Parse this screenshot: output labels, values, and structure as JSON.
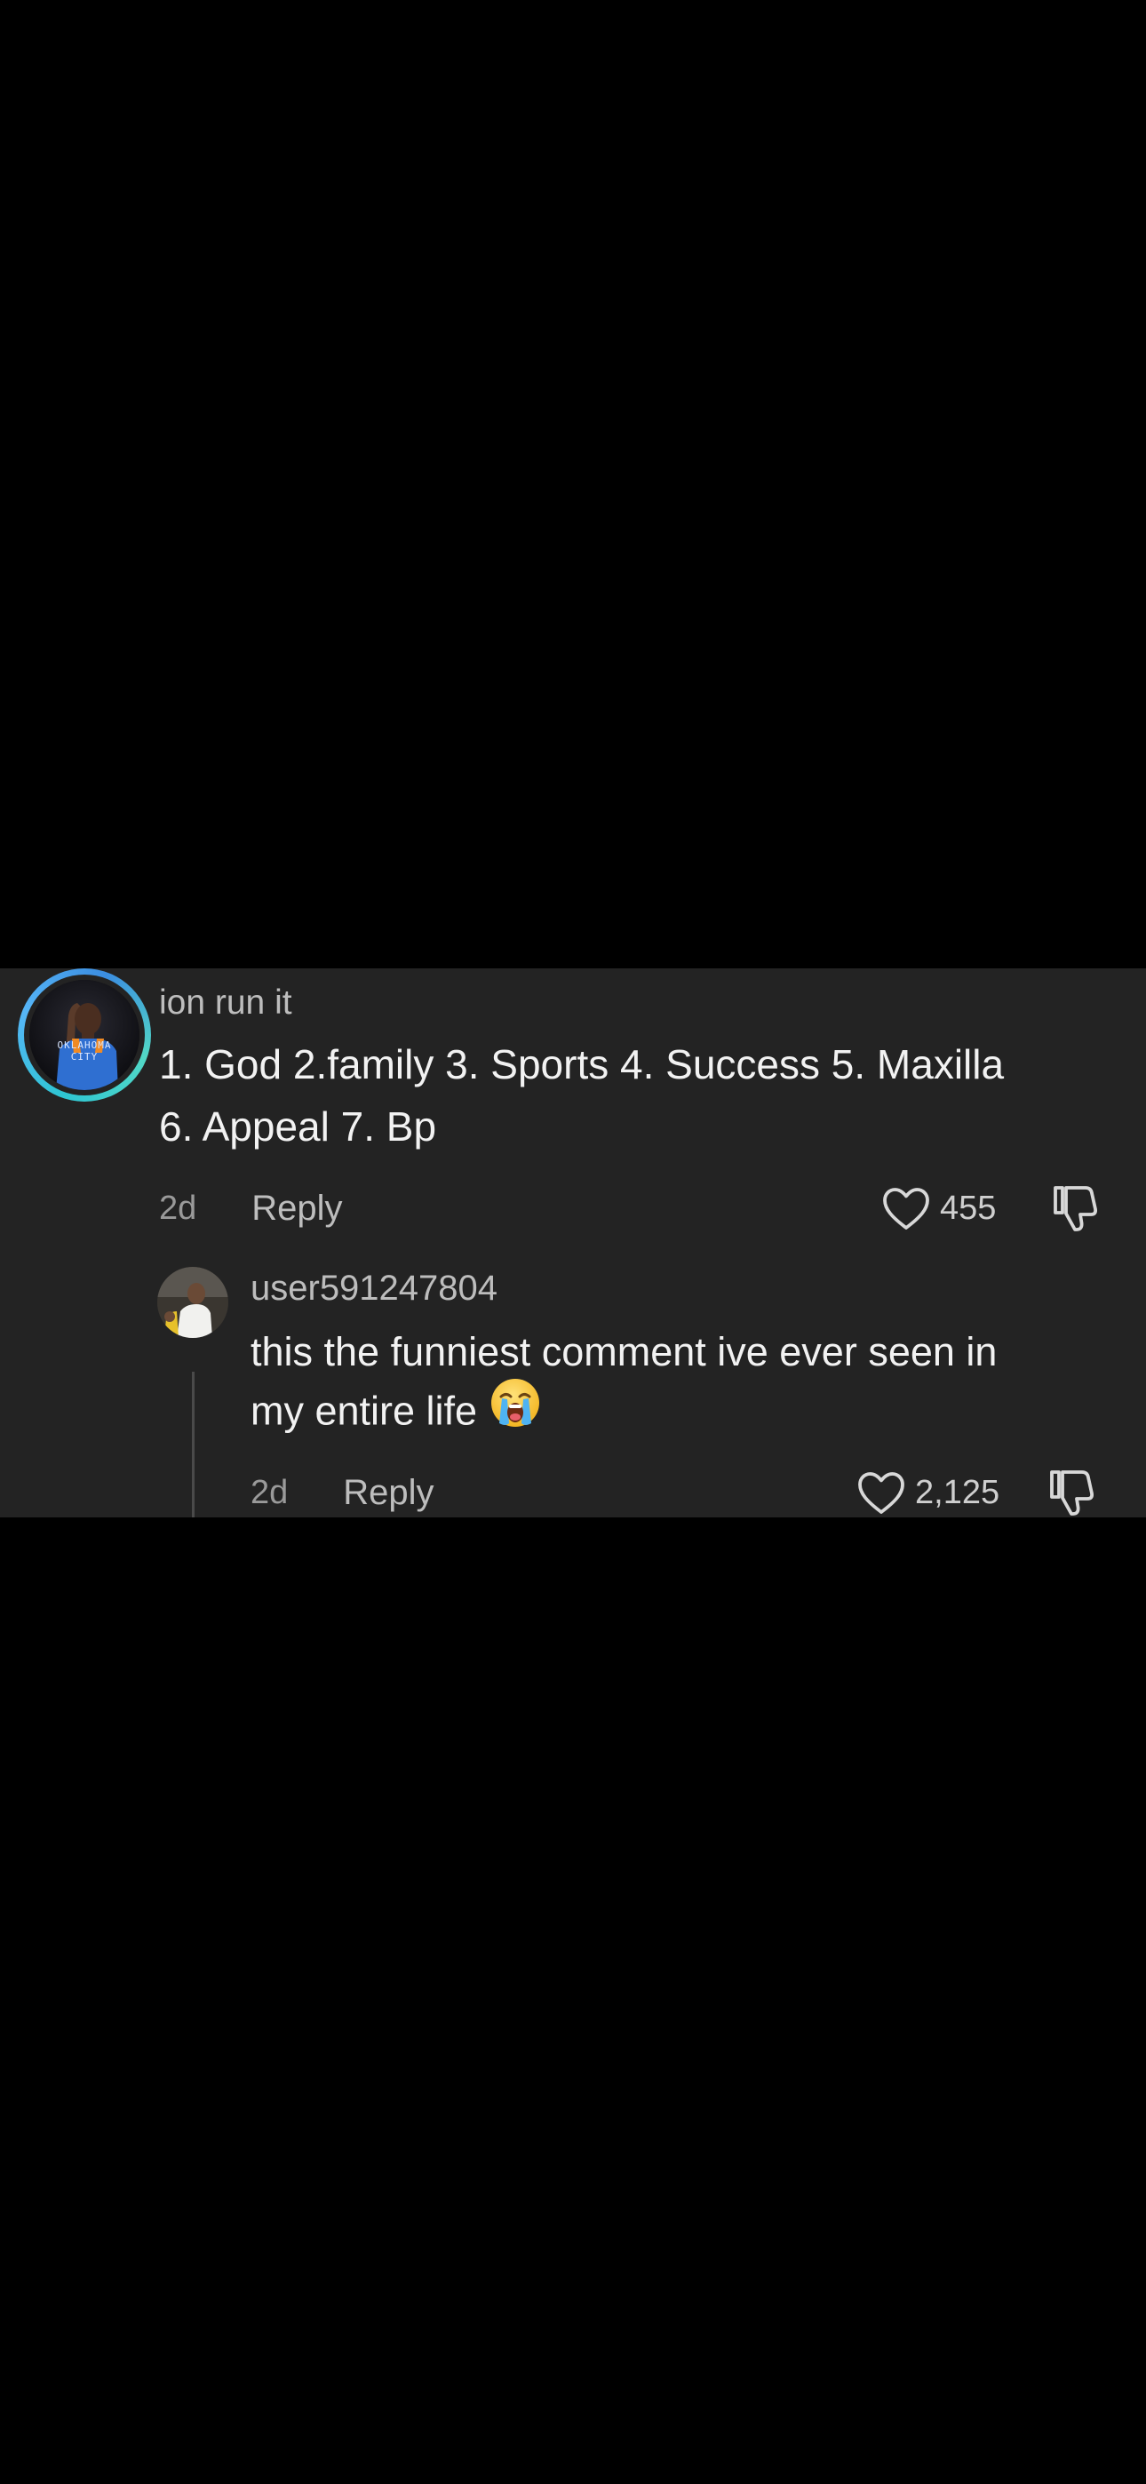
{
  "comment": {
    "username": "ion run it",
    "text_lines": [
      "1. God 2.family 3. Sports 4. Success 5. Maxilla",
      "6. Appeal 7. Bp"
    ],
    "time": "2d",
    "reply_label": "Reply",
    "like_count": "455",
    "avatar_text_lines": [
      "OKLAHOMA",
      "CITY"
    ]
  },
  "reply": {
    "username": "user591247804",
    "text_lines": [
      "this the funniest comment ive ever seen in",
      "my entire life"
    ],
    "emoji": "loudly-crying-face",
    "time": "2d",
    "reply_label": "Reply",
    "like_count": "2,125"
  },
  "colors": {
    "background": "#000000",
    "panel": "#232323",
    "ring": "#3bb8e8"
  }
}
